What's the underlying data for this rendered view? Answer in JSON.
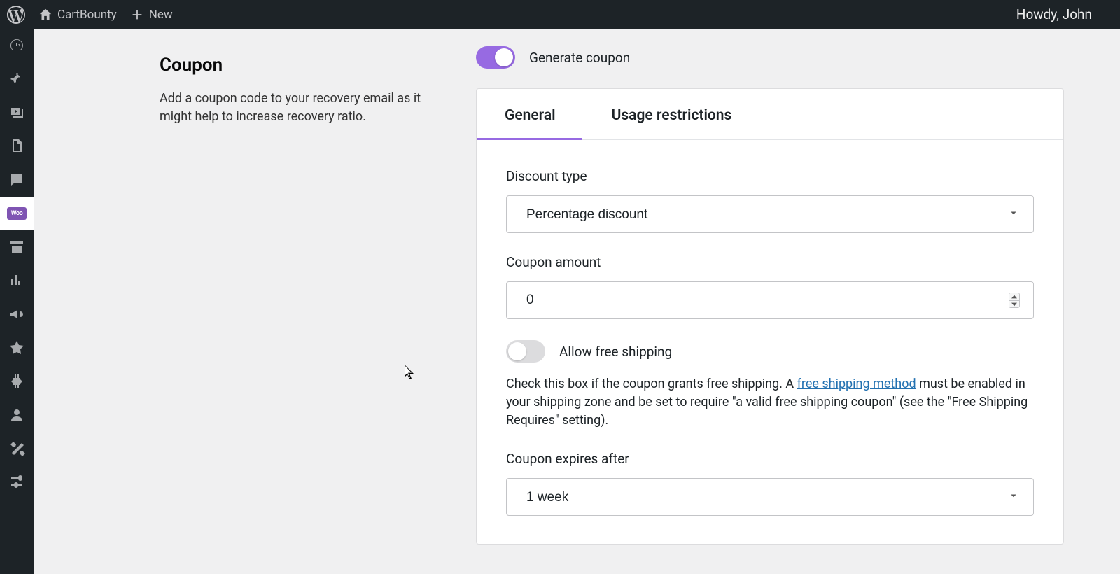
{
  "adminbar": {
    "site_name": "CartBounty",
    "new_label": "New",
    "howdy": "Howdy, John"
  },
  "sidebar": {
    "items": [
      {
        "name": "dashboard"
      },
      {
        "name": "posts"
      },
      {
        "name": "media"
      },
      {
        "name": "pages"
      },
      {
        "name": "comments"
      },
      {
        "name": "woocommerce"
      },
      {
        "name": "products"
      },
      {
        "name": "analytics"
      },
      {
        "name": "marketing"
      },
      {
        "name": "appearance"
      },
      {
        "name": "plugins"
      },
      {
        "name": "users"
      },
      {
        "name": "tools"
      },
      {
        "name": "settings"
      }
    ]
  },
  "coupon": {
    "title": "Coupon",
    "description": "Add a coupon code to your recovery email as it might help to increase recovery ratio.",
    "generate_label": "Generate coupon",
    "generate_enabled": true,
    "tabs": {
      "general_label": "General",
      "restrictions_label": "Usage restrictions",
      "active": "general"
    },
    "fields": {
      "discount_type_label": "Discount type",
      "discount_type_value": "Percentage discount",
      "coupon_amount_label": "Coupon amount",
      "coupon_amount_value": "0",
      "free_shipping_label": "Allow free shipping",
      "free_shipping_enabled": false,
      "free_shipping_help_before": "Check this box if the coupon grants free shipping. A ",
      "free_shipping_link_text": "free shipping method",
      "free_shipping_help_after": " must be enabled in your shipping zone and be set to require \"a valid free shipping coupon\" (see the \"Free Shipping Requires\" setting).",
      "expires_label": "Coupon expires after",
      "expires_value": "1 week"
    }
  }
}
